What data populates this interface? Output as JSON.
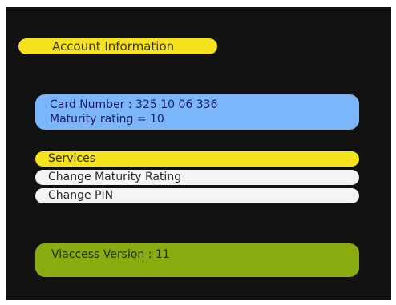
{
  "title": "Account Information",
  "card_info": {
    "card_number": "Card Number : 325 10 06 336",
    "maturity_rating": "Maturity rating = 10"
  },
  "menu": {
    "items": [
      {
        "label": "Services",
        "selected": true
      },
      {
        "label": "Change Maturity Rating",
        "selected": false
      },
      {
        "label": "Change PIN",
        "selected": false
      }
    ]
  },
  "version": {
    "text": "Viaccess Version : 11"
  },
  "colors": {
    "background": "#121212",
    "highlight": "#f5e21b",
    "info_panel": "#7ab6f9",
    "menu_item": "#f4f4f4",
    "version_panel": "#8bac10"
  }
}
